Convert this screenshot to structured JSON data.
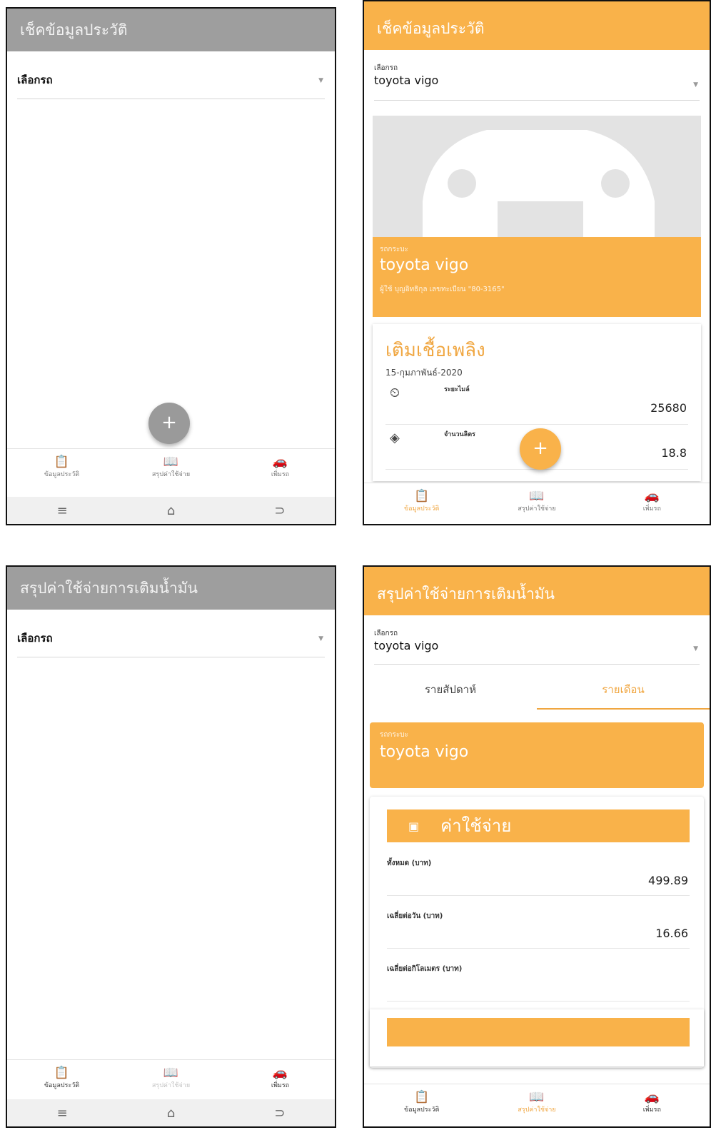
{
  "panel1": {
    "title": "เช็คข้อมูลประวัติ",
    "select_label": "เลือกรถ",
    "fab": "+",
    "nav": [
      "ข้อมูลประวัติ",
      "สรุปค่าใช้จ่าย",
      "เพิ่มรถ"
    ],
    "sys": [
      "≡",
      "⌂",
      "⊃"
    ]
  },
  "panel2": {
    "title": "เช็คข้อมูลประวัติ",
    "select_label": "เลือกรถ",
    "select_value": "toyota vigo",
    "car_small": "รถกระบะ",
    "car_name": "toyota vigo",
    "owner": "ผู้ใช้ บุญอิทธิกุล เลขทะเบียน \"80-3165\"",
    "fuel_title": "เติมเชื้อเพลิง",
    "fuel_date": "15-กุมภาพันธ์-2020",
    "rows": [
      {
        "name": "ระยะไมล์",
        "value": "25680"
      },
      {
        "name": "จำนวนลิตร",
        "value": "18.8"
      }
    ],
    "fab": "+",
    "nav": [
      "ข้อมูลประวัติ",
      "สรุปค่าใช้จ่าย",
      "เพิ่มรถ"
    ]
  },
  "panel3": {
    "title": "สรุปค่าใช้จ่ายการเติมน้ำมัน",
    "select_label": "เลือกรถ",
    "nav": [
      "ข้อมูลประวัติ",
      "สรุปค่าใช้จ่าย",
      "เพิ่มรถ"
    ],
    "sys": [
      "≡",
      "⌂",
      "⊃"
    ]
  },
  "panel4": {
    "title": "สรุปค่าใช้จ่ายการเติมน้ำมัน",
    "select_label": "เลือกรถ",
    "select_value": "toyota vigo",
    "tabs": [
      "รายสัปดาห์",
      "รายเดือน"
    ],
    "car_small": "รถกระบะ",
    "car_name": "toyota vigo",
    "cost_title": "ค่าใช้จ่าย",
    "rows": [
      {
        "name": "ทั้งหมด (บาท)",
        "value": "499.89"
      },
      {
        "name": "เฉลี่ยต่อวัน (บาท)",
        "value": "16.66"
      },
      {
        "name": "เฉลี่ยต่อกิโลเมตร (บาท)",
        "value": ""
      }
    ],
    "nav": [
      "ข้อมูลประวัติ",
      "สรุปค่าใช้จ่าย",
      "เพิ่มรถ"
    ]
  },
  "colors": {
    "accent": "#f9b24a",
    "grey_bar": "#9e9e9e"
  },
  "icons": [
    "clipboard-icon",
    "book-icon",
    "car-icon",
    "gauge-icon",
    "fuel-icon",
    "money-icon"
  ]
}
